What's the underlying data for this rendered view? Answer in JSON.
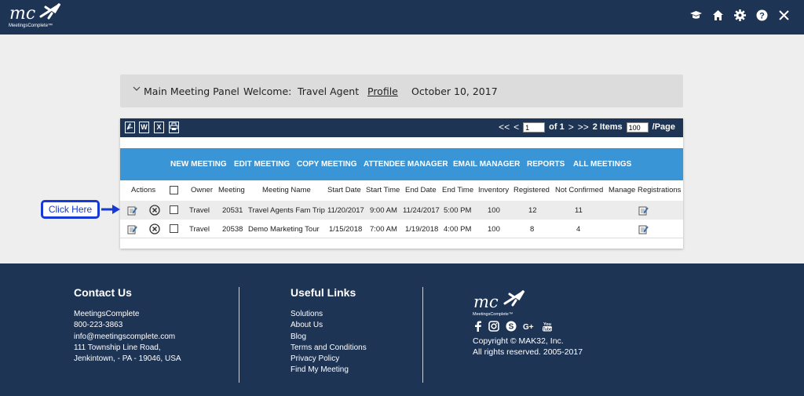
{
  "header": {
    "logo_text": "mc",
    "logo_sub": "MeetingsComplete™",
    "icons": [
      "graduation-cap-icon",
      "home-icon",
      "gear-icon",
      "help-icon",
      "close-icon"
    ]
  },
  "panel": {
    "title": "Main Meeting Panel",
    "welcome_label": "Welcome:",
    "user": "Travel Agent",
    "profile_link": "Profile",
    "date": "October 10, 2017"
  },
  "toolbar": {
    "export_icons": [
      "pdf-icon",
      "word-icon",
      "excel-icon",
      "print-icon"
    ],
    "first": "<<",
    "prev": "<",
    "page_value": "1",
    "of_pages": "of 1",
    "next": ">",
    "last": ">>",
    "items": "2 Items",
    "per_page_value": "100",
    "per_page_label": "/Page"
  },
  "menu": [
    "NEW MEETING",
    "EDIT MEETING",
    "COPY MEETING",
    "ATTENDEE MANAGER",
    "EMAIL MANAGER",
    "REPORTS",
    "ALL MEETINGS"
  ],
  "table": {
    "headers": [
      "Actions",
      "Owner",
      "Meeting",
      "Meeting Name",
      "Start Date",
      "Start Time",
      "End Date",
      "End Time",
      "Inventory",
      "Registered",
      "Not Confirmed",
      "Manage Registrations"
    ],
    "rows": [
      {
        "owner": "Travel",
        "meeting": "20531",
        "name": "Travel Agents Fam Trip",
        "start_date": "11/20/2017",
        "start_time": "9:00 AM",
        "end_date": "11/24/2017",
        "end_time": "5:00 PM",
        "inventory": "100",
        "registered": "12",
        "not_confirmed": "11"
      },
      {
        "owner": "Travel",
        "meeting": "20538",
        "name": "Demo Marketing Tour",
        "start_date": "1/15/2018",
        "start_time": "7:00 AM",
        "end_date": "1/19/2018",
        "end_time": "4:00 PM",
        "inventory": "100",
        "registered": "8",
        "not_confirmed": "4"
      }
    ]
  },
  "callout": "Click Here",
  "footer": {
    "contact_title": "Contact Us",
    "contact_lines": [
      "MeetingsComplete",
      "800-223-3863",
      "info@meetingscomplete.com",
      "111 Township Line Road,",
      "Jenkintown, - PA - 19046, USA"
    ],
    "links_title": "Useful Links",
    "links": [
      "Solutions",
      "About Us",
      "Blog",
      "Terms and Conditions",
      "Privacy Policy",
      "Find My Meeting"
    ],
    "logo_text": "mc",
    "logo_sub": "MeetingsComplete™",
    "social_icons": [
      "facebook-icon",
      "instagram-icon",
      "skype-icon",
      "google-plus-icon",
      "youtube-icon"
    ],
    "copyright": "Copyright © MAK32, Inc.",
    "rights": "All rights reserved. 2005-2017"
  }
}
